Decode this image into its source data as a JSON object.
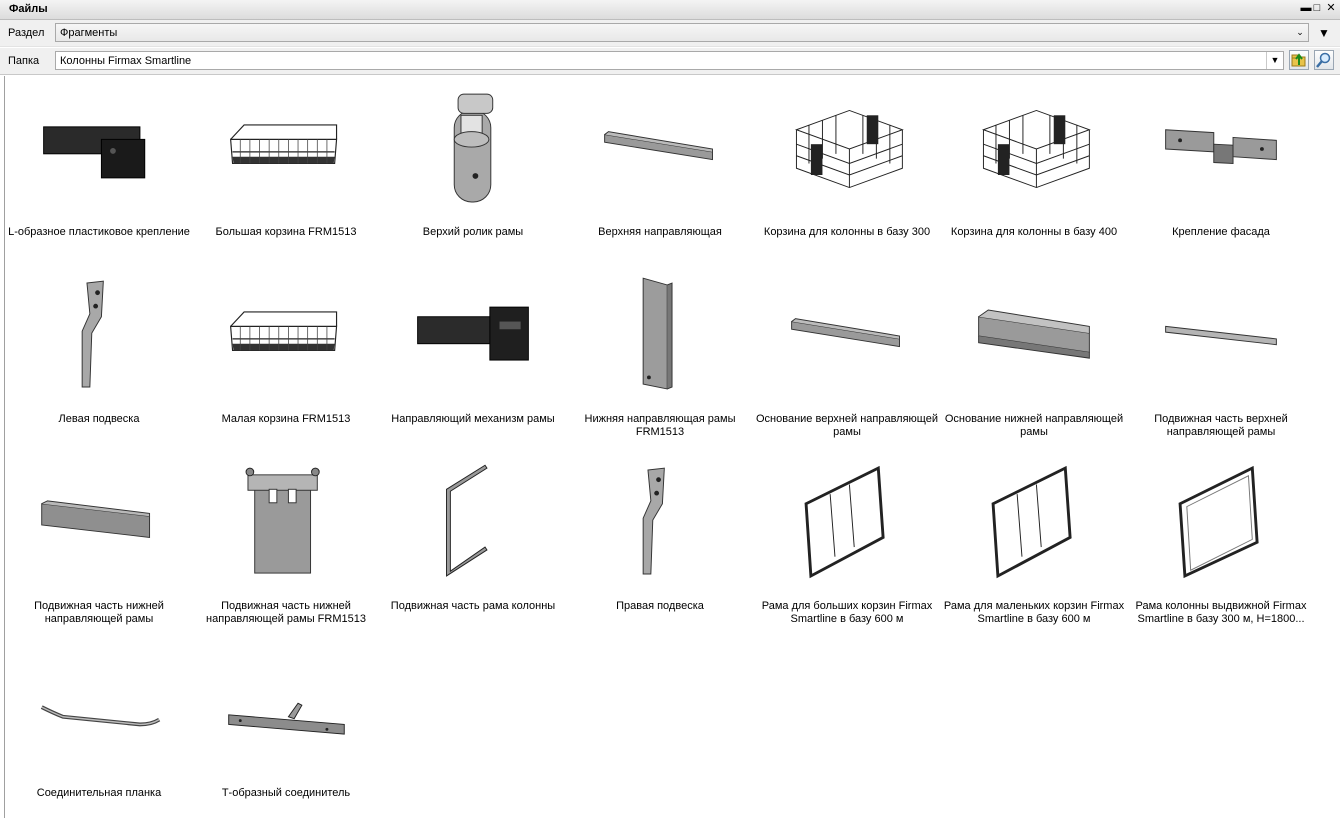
{
  "window": {
    "title": "Файлы"
  },
  "section": {
    "label": "Раздел",
    "value": "Фрагменты"
  },
  "folder": {
    "label": "Папка",
    "value": "Колонны Firmax Smartline"
  },
  "items": [
    {
      "label": "L-образное пластиковое крепление",
      "icon": "l-bracket"
    },
    {
      "label": "Большая корзина FRM1513",
      "icon": "basket"
    },
    {
      "label": "Верхий ролик рамы",
      "icon": "roller"
    },
    {
      "label": "Верхняя направляющая",
      "icon": "rail"
    },
    {
      "label": "Корзина для колонны в базу 300",
      "icon": "basket-box"
    },
    {
      "label": "Корзина для колонны в базу 400",
      "icon": "basket-box"
    },
    {
      "label": "Крепление фасада",
      "icon": "facade-mount"
    },
    {
      "label": "Левая подвеска",
      "icon": "hanger"
    },
    {
      "label": "Малая корзина FRM1513",
      "icon": "basket"
    },
    {
      "label": "Направляющий механизм рамы",
      "icon": "black-mechanism"
    },
    {
      "label": "Нижняя направляющая рамы FRM1513",
      "icon": "vertical-plate"
    },
    {
      "label": "Основание верхней направляющей рамы",
      "icon": "rail"
    },
    {
      "label": "Основание нижней направляющей рамы",
      "icon": "channel"
    },
    {
      "label": "Подвижная часть верхней направляющей  рамы",
      "icon": "thin-rail"
    },
    {
      "label": "Подвижная часть нижней направляющей рамы",
      "icon": "beam"
    },
    {
      "label": "Подвижная часть нижней направляющей рамы FRM1513",
      "icon": "plate"
    },
    {
      "label": "Подвижная часть рама колонны",
      "icon": "side-frame"
    },
    {
      "label": "Правая подвеска",
      "icon": "hanger"
    },
    {
      "label": "Рама для больших корзин Firmax Smartline в базу 600 м",
      "icon": "frame"
    },
    {
      "label": "Рама для маленьких корзин Firmax Smartline в базу 600 м",
      "icon": "frame"
    },
    {
      "label": "Рама колонны выдвижной Firmax Smartline в базу 300 м, H=1800...",
      "icon": "frame-plain"
    },
    {
      "label": "Соединительная планка",
      "icon": "strip"
    },
    {
      "label": "Т-образный соединитель",
      "icon": "t-connector"
    }
  ]
}
